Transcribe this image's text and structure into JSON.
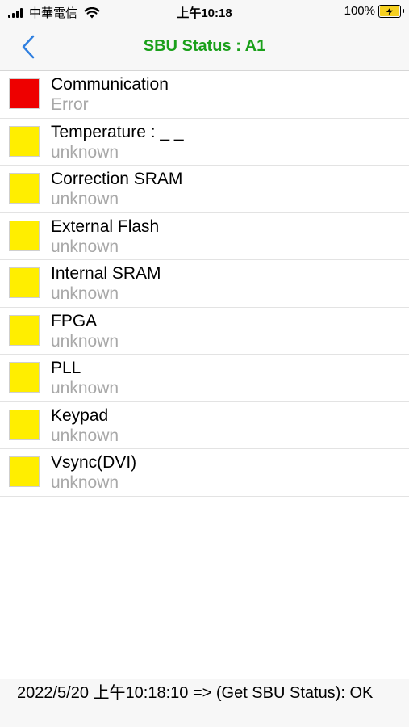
{
  "status_bar": {
    "carrier": "中華電信",
    "time": "上午10:18",
    "battery": "100%"
  },
  "nav": {
    "title": "SBU Status : A1",
    "title_color": "#1aa01a"
  },
  "items": [
    {
      "title": "Communication",
      "status": "Error",
      "color": "#ee0000"
    },
    {
      "title": "Temperature : _ _",
      "status": "unknown",
      "color": "#ffee00"
    },
    {
      "title": "Correction SRAM",
      "status": "unknown",
      "color": "#ffee00"
    },
    {
      "title": "External Flash",
      "status": "unknown",
      "color": "#ffee00"
    },
    {
      "title": "Internal SRAM",
      "status": "unknown",
      "color": "#ffee00"
    },
    {
      "title": "FPGA",
      "status": "unknown",
      "color": "#ffee00"
    },
    {
      "title": "PLL",
      "status": "unknown",
      "color": "#ffee00"
    },
    {
      "title": "Keypad",
      "status": "unknown",
      "color": "#ffee00"
    },
    {
      "title": "Vsync(DVI)",
      "status": "unknown",
      "color": "#ffee00"
    }
  ],
  "footer": {
    "log": "2022/5/20 上午10:18:10 => (Get SBU Status): OK"
  }
}
